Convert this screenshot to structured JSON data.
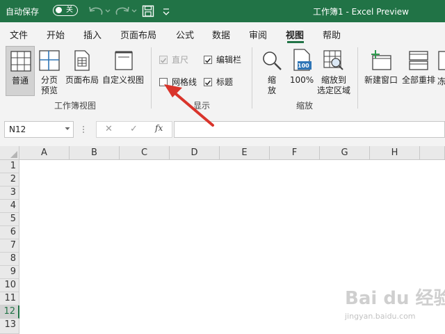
{
  "titlebar": {
    "autosave_label": "自动保存",
    "toggle_state": "关",
    "doc_title": "工作簿1  -  Excel Preview"
  },
  "tabs": [
    {
      "label": "文件",
      "active": false
    },
    {
      "label": "开始",
      "active": false
    },
    {
      "label": "插入",
      "active": false
    },
    {
      "label": "页面布局",
      "active": false
    },
    {
      "label": "公式",
      "active": false
    },
    {
      "label": "数据",
      "active": false
    },
    {
      "label": "审阅",
      "active": false
    },
    {
      "label": "视图",
      "active": true
    },
    {
      "label": "帮助",
      "active": false
    }
  ],
  "ribbon": {
    "workbook_views": {
      "normal": "普通",
      "page_break_1": "分页",
      "page_break_2": "预览",
      "page_layout": "页面布局",
      "custom_views": "自定义视图",
      "group_label": "工作簿视图"
    },
    "show": {
      "ruler": "直尺",
      "formula_bar": "编辑栏",
      "gridlines": "网格线",
      "headings": "标题",
      "group_label": "显示"
    },
    "zoom": {
      "zoom_1": "缩",
      "zoom_2": "放",
      "hundred": "100%",
      "hundred_icon_text": "100",
      "zoom_selection_1": "缩放到",
      "zoom_selection_2": "选定区域",
      "group_label": "缩放"
    },
    "window": {
      "new_window": "新建窗口",
      "arrange_all": "全部重排",
      "freeze_partial": "冻"
    }
  },
  "formula_bar": {
    "name_box": "N12",
    "fx_label": "fx",
    "cancel_glyph": "✕",
    "enter_glyph": "✓",
    "formula_value": ""
  },
  "sheet": {
    "columns": [
      "A",
      "B",
      "C",
      "D",
      "E",
      "F",
      "G",
      "H"
    ],
    "rows": [
      "1",
      "2",
      "3",
      "4",
      "5",
      "6",
      "7",
      "8",
      "9",
      "10",
      "11",
      "12",
      "13"
    ],
    "selected_row": "12"
  },
  "watermark": {
    "logo": "Bai du 经验",
    "url": "jingyan.baidu.com"
  },
  "colors": {
    "excel_green": "#217346",
    "arrow_red": "#d9342b"
  }
}
